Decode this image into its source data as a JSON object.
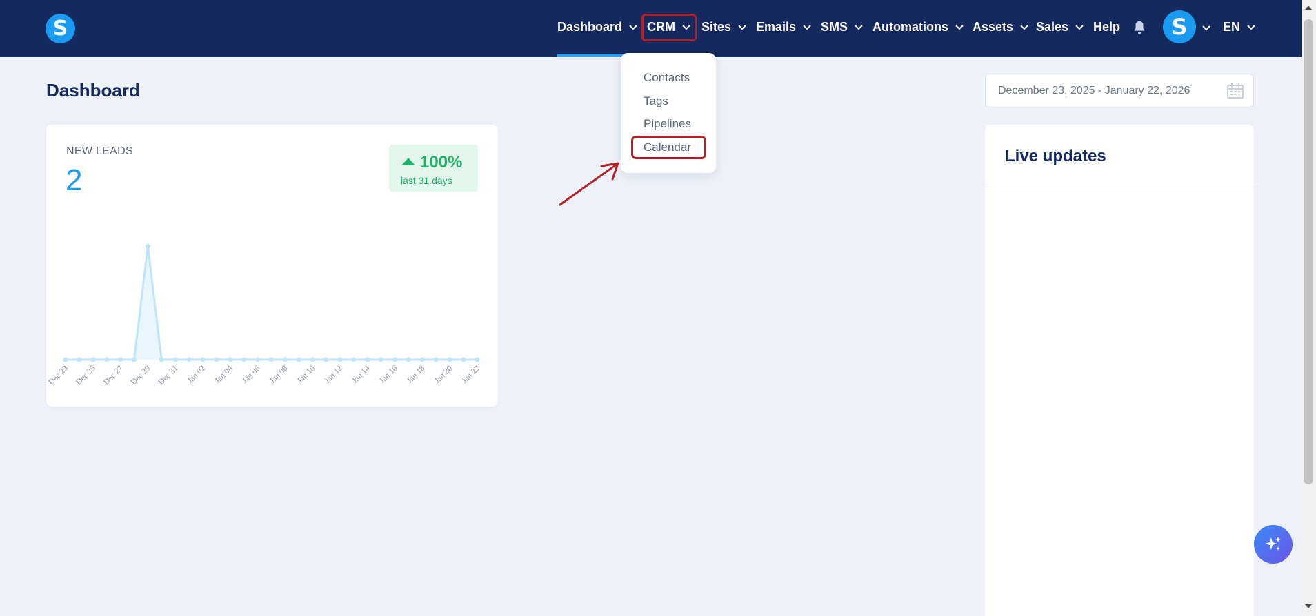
{
  "nav": {
    "logo_letter": "S",
    "items": [
      {
        "label": "Dashboard",
        "has_chevron": true
      },
      {
        "label": "CRM",
        "has_chevron": true
      },
      {
        "label": "Sites",
        "has_chevron": true
      },
      {
        "label": "Emails",
        "has_chevron": true
      },
      {
        "label": "SMS",
        "has_chevron": true
      },
      {
        "label": "Automations",
        "has_chevron": true
      },
      {
        "label": "Assets",
        "has_chevron": true
      },
      {
        "label": "Sales",
        "has_chevron": true
      },
      {
        "label": "Help",
        "has_chevron": false
      }
    ],
    "avatar_letter": "S",
    "language": "EN",
    "active_item": "Dashboard",
    "highlight_color": "#b32025"
  },
  "crm_menu": {
    "items": [
      "Contacts",
      "Tags",
      "Pipelines",
      "Calendar"
    ],
    "highlighted": "Calendar"
  },
  "page": {
    "title": "Dashboard",
    "date_range": "December 23, 2025 - January 22, 2026"
  },
  "leads_card": {
    "label": "NEW LEADS",
    "value": "2",
    "change_pct": "100%",
    "change_period": "last 31 days"
  },
  "live_updates": {
    "title": "Live updates"
  },
  "chart_data": {
    "type": "area",
    "title": "",
    "x": [
      "Dec 23",
      "Dec 24",
      "Dec 25",
      "Dec 26",
      "Dec 27",
      "Dec 28",
      "Dec 29",
      "Dec 30",
      "Dec 31",
      "Jan 01",
      "Jan 02",
      "Jan 03",
      "Jan 04",
      "Jan 05",
      "Jan 06",
      "Jan 07",
      "Jan 08",
      "Jan 09",
      "Jan 10",
      "Jan 11",
      "Jan 12",
      "Jan 13",
      "Jan 14",
      "Jan 15",
      "Jan 16",
      "Jan 17",
      "Jan 18",
      "Jan 19",
      "Jan 20",
      "Jan 21",
      "Jan 22"
    ],
    "tick_labels": [
      "Dec 23",
      "Dec 25",
      "Dec 27",
      "Dec 29",
      "Dec 31",
      "Jan 02",
      "Jan 04",
      "Jan 06",
      "Jan 08",
      "Jan 10",
      "Jan 12",
      "Jan 14",
      "Jan 16",
      "Jan 18",
      "Jan 20",
      "Jan 22"
    ],
    "series": [
      {
        "values": [
          0,
          0,
          0,
          0,
          0,
          0,
          2,
          0,
          0,
          0,
          0,
          0,
          0,
          0,
          0,
          0,
          0,
          0,
          0,
          0,
          0,
          0,
          0,
          0,
          0,
          0,
          0,
          0,
          0,
          0,
          0
        ]
      }
    ],
    "ylim": [
      0,
      2.2
    ],
    "color": "#bfe4fb",
    "grid": false
  }
}
